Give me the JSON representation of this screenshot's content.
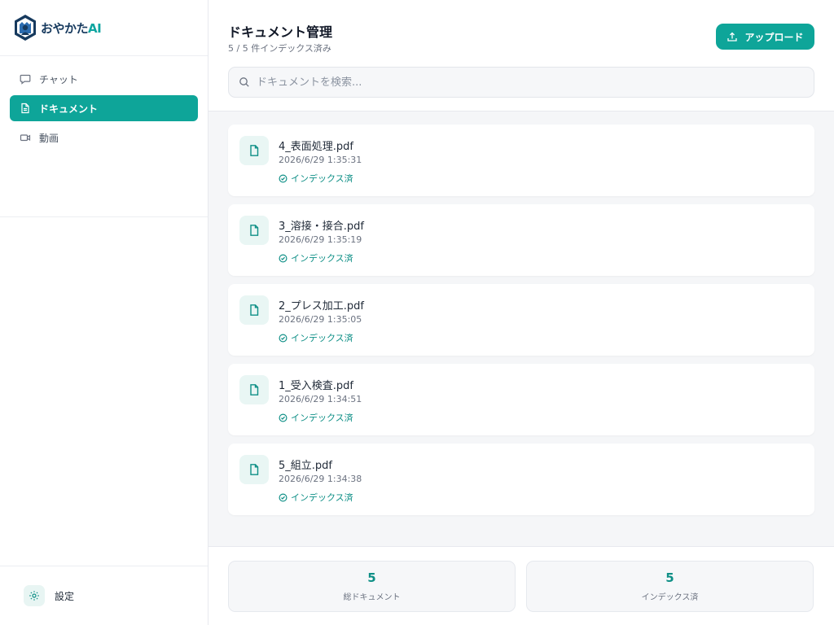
{
  "brand": {
    "name_part1": "おやかた",
    "name_part2": "AI"
  },
  "nav": [
    {
      "label": "チャット",
      "icon": "chat-icon",
      "active": false
    },
    {
      "label": "ドキュメント",
      "icon": "document-icon",
      "active": true
    },
    {
      "label": "動画",
      "icon": "video-icon",
      "active": false
    }
  ],
  "settings": {
    "label": "設定",
    "icon": "gear-icon"
  },
  "header": {
    "title": "ドキュメント管理",
    "subtitle": "5 / 5 件インデックス済み",
    "upload_label": "アップロード"
  },
  "search": {
    "placeholder": "ドキュメントを検索..."
  },
  "documents": [
    {
      "name": "4_表面処理.pdf",
      "date": "2026/6/29 1:35:31",
      "status": "インデックス済"
    },
    {
      "name": "3_溶接・接合.pdf",
      "date": "2026/6/29 1:35:19",
      "status": "インデックス済"
    },
    {
      "name": "2_プレス加工.pdf",
      "date": "2026/6/29 1:35:05",
      "status": "インデックス済"
    },
    {
      "name": "1_受入検査.pdf",
      "date": "2026/6/29 1:34:51",
      "status": "インデックス済"
    },
    {
      "name": "5_組立.pdf",
      "date": "2026/6/29 1:34:38",
      "status": "インデックス済"
    }
  ],
  "stats": [
    {
      "value": "5",
      "label": "総ドキュメント"
    },
    {
      "value": "5",
      "label": "インデックス済"
    }
  ],
  "colors": {
    "accent": "#0ea599",
    "accent_dark": "#0e8f86",
    "brand_navy": "#173a5e"
  }
}
